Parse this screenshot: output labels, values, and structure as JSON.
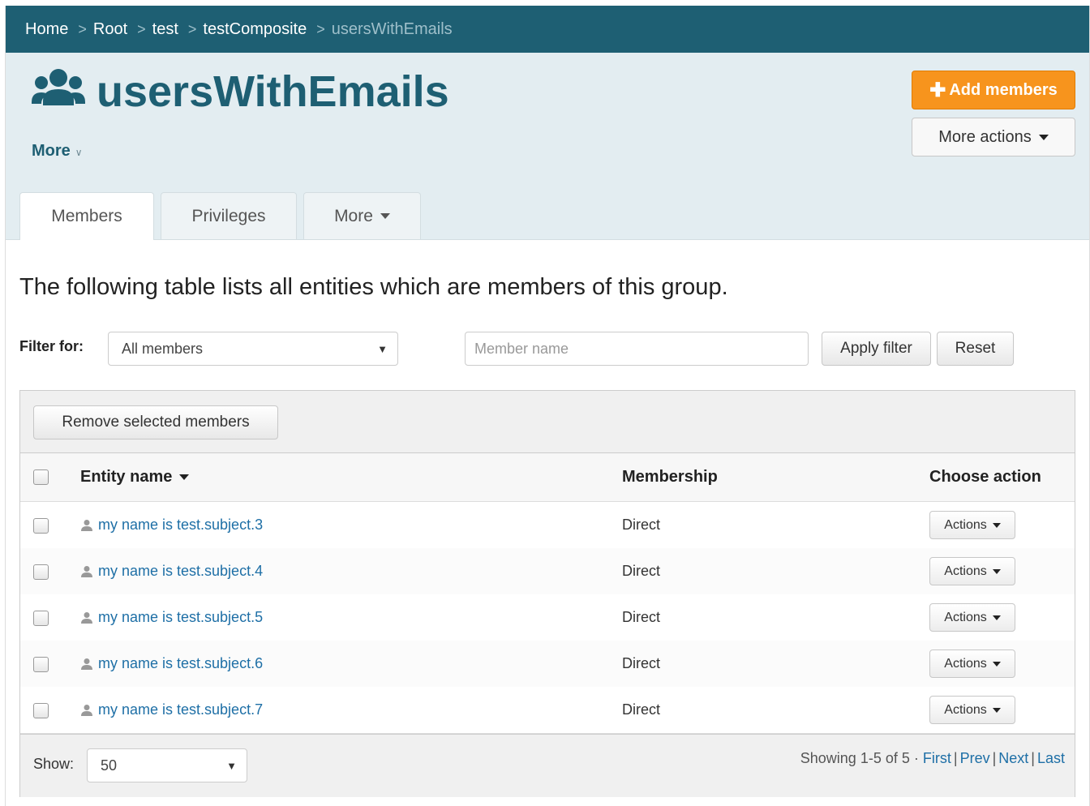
{
  "breadcrumb": {
    "items": [
      "Home",
      "Root",
      "test",
      "testComposite"
    ],
    "current": "usersWithEmails",
    "separator": ">"
  },
  "header": {
    "icon": "users-icon",
    "title": "usersWithEmails",
    "more_label": "More",
    "add_members_label": "Add members",
    "more_actions_label": "More actions"
  },
  "tabs": [
    {
      "label": "Members",
      "active": true
    },
    {
      "label": "Privileges",
      "active": false
    },
    {
      "label": "More",
      "active": false
    }
  ],
  "intro": "The following table lists all entities which are members of this group.",
  "filter": {
    "label": "Filter for:",
    "select_value": "All members",
    "input_placeholder": "Member name",
    "apply_label": "Apply filter",
    "reset_label": "Reset"
  },
  "table": {
    "remove_label": "Remove selected members",
    "columns": {
      "entity": "Entity name",
      "membership": "Membership",
      "action": "Choose action"
    },
    "rows": [
      {
        "entity": "my name is test.subject.3",
        "membership": "Direct",
        "action": "Actions"
      },
      {
        "entity": "my name is test.subject.4",
        "membership": "Direct",
        "action": "Actions"
      },
      {
        "entity": "my name is test.subject.5",
        "membership": "Direct",
        "action": "Actions"
      },
      {
        "entity": "my name is test.subject.6",
        "membership": "Direct",
        "action": "Actions"
      },
      {
        "entity": "my name is test.subject.7",
        "membership": "Direct",
        "action": "Actions"
      }
    ]
  },
  "footer": {
    "show_label": "Show:",
    "show_value": "50",
    "showing": "Showing 1-5 of 5 ·",
    "first": "First",
    "prev": "Prev",
    "next": "Next",
    "last": "Last"
  },
  "colors": {
    "brand": "#1e5f73",
    "header_bg": "#e3edf1",
    "accent_orange": "#f7941d",
    "link": "#1e6fa6"
  }
}
